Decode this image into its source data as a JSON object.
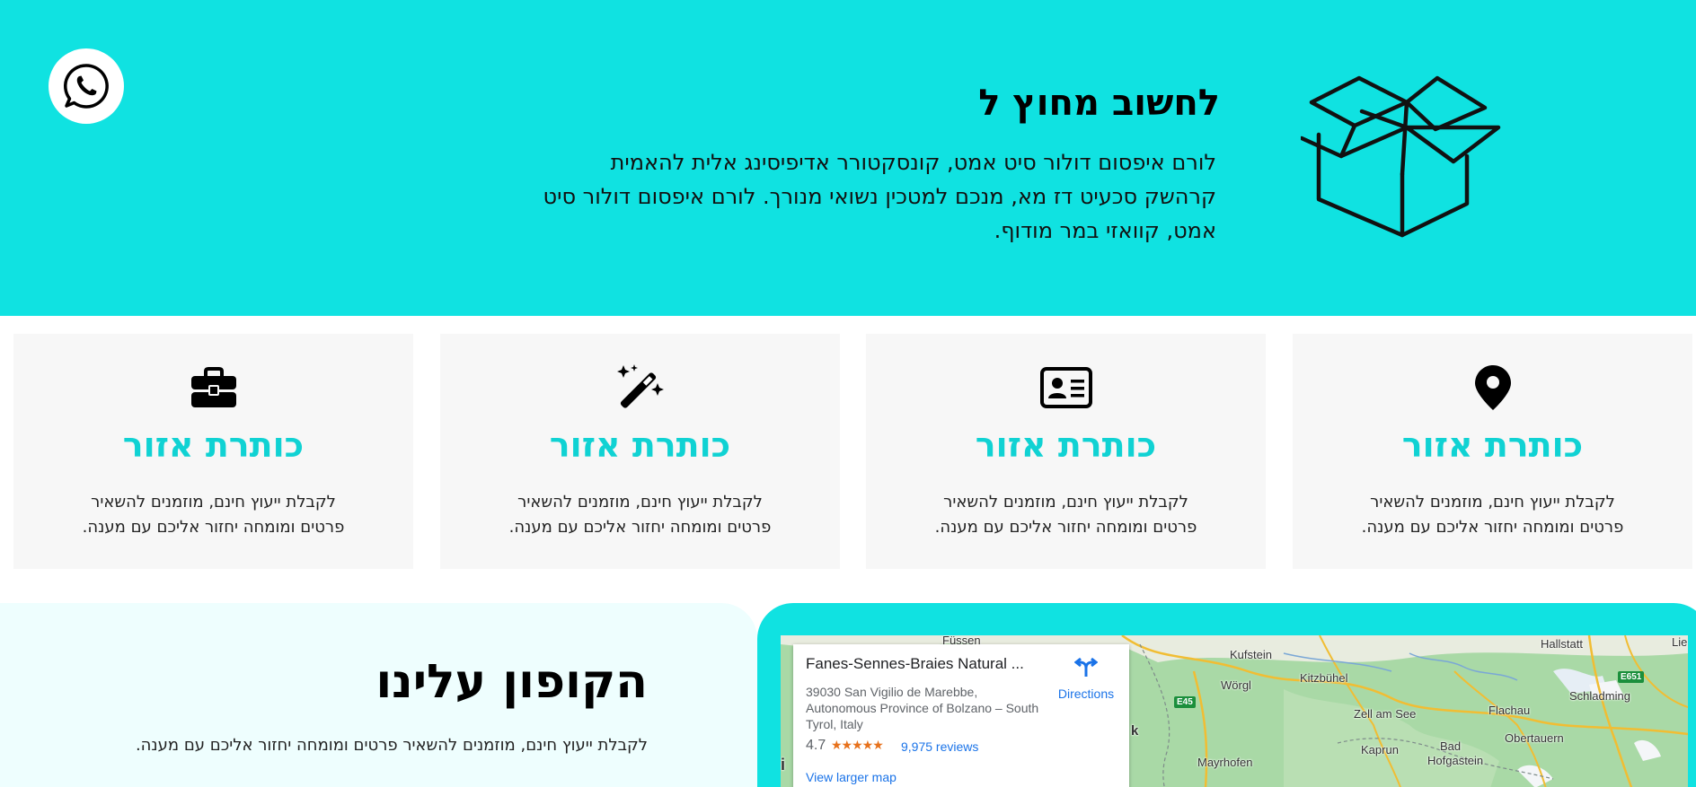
{
  "hero": {
    "title": "לחשוב מחוץ ל",
    "text": "לורם איפסום דולור סיט אמט, קונסקטורר אדיפיסינג אלית להאמית קרהשק סכעיט דז מא, מנכם למטכין נשואי מנורך. לורם איפסום דולור סיט אמט, קוואזי במר מודוף.",
    "background": "#10e2e1"
  },
  "features": [
    {
      "icon": "map-pin-icon",
      "title": "כותרת אזור",
      "text": "לקבלת ייעוץ חינם, מוזמנים להשאיר פרטים ומומחה יחזור אליכם עם מענה."
    },
    {
      "icon": "id-card-icon",
      "title": "כותרת אזור",
      "text": "לקבלת ייעוץ חינם, מוזמנים להשאיר פרטים ומומחה יחזור אליכם עם מענה."
    },
    {
      "icon": "magic-wand-icon",
      "title": "כותרת אזור",
      "text": "לקבלת ייעוץ חינם, מוזמנים להשאיר פרטים ומומחה יחזור אליכם עם מענה."
    },
    {
      "icon": "briefcase-icon",
      "title": "כותרת אזור",
      "text": "לקבלת ייעוץ חינם, מוזמנים להשאיר פרטים ומומחה יחזור אליכם עם מענה."
    }
  ],
  "coupon": {
    "title": "הקופון עלינו",
    "text": "לקבלת ייעוץ חינם, מוזמנים להשאיר פרטים ומומחה יחזור אליכם עם מענה."
  },
  "map": {
    "place_name": "Fanes-Sennes-Braies Natural ...",
    "address": "39030 San Vigilio de Marebbe, Autonomous Province of Bolzano – South Tyrol, Italy",
    "rating": "4.7",
    "stars": "★★★★★",
    "reviews": "9,975 reviews",
    "directions": "Directions",
    "larger_map": "View larger map",
    "labels": {
      "fussen": "Füssen",
      "kufstein": "Kufstein",
      "worgl": "Wörgl",
      "kitzbuhel": "Kitzbühel",
      "hallstatt": "Hallstatt",
      "lie": "Lie",
      "schladming": "Schladming",
      "zellamsee": "Zell am See",
      "flachau": "Flachau",
      "obertauern": "Obertauern",
      "kaprun": "Kaprun",
      "bad": "Bad",
      "hofgastein": "Hofgastein",
      "mayrhofen": "Mayrhofen",
      "k": "k",
      "i": "i"
    },
    "shields": {
      "e45": "E45",
      "e651": "E651"
    }
  }
}
